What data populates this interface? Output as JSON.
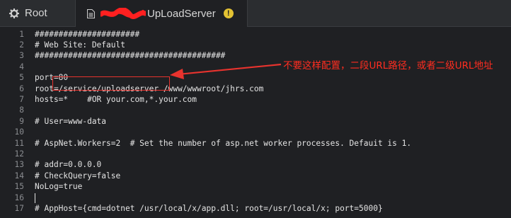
{
  "tabs": [
    {
      "label": "Root"
    },
    {
      "label": "UpLoadServer",
      "warning_glyph": "!"
    }
  ],
  "colors": {
    "accent_annotation": "#e8332e",
    "warning": "#e3c233",
    "background": "#1f2023"
  },
  "icons": [
    "gear-icon",
    "file-icon",
    "warning-icon",
    "redaction-scribble"
  ],
  "editor": {
    "lines": [
      {
        "n": "1",
        "text": "######################"
      },
      {
        "n": "2",
        "text": "# Web Site: Default"
      },
      {
        "n": "3",
        "text": "########################################"
      },
      {
        "n": "4",
        "text": ""
      },
      {
        "n": "5",
        "text": "port=80"
      },
      {
        "n": "6",
        "text": "root=/service/uploadserver /www/wwwroot/jhrs.com"
      },
      {
        "n": "7",
        "text": "hosts=*    #OR your.com,*.your.com"
      },
      {
        "n": "8",
        "text": ""
      },
      {
        "n": "9",
        "text": "# User=www-data"
      },
      {
        "n": "10",
        "text": ""
      },
      {
        "n": "11",
        "text": "# AspNet.Workers=2  # Set the number of asp.net worker processes. Defauit is 1."
      },
      {
        "n": "12",
        "text": ""
      },
      {
        "n": "13",
        "text": "# addr=0.0.0.0"
      },
      {
        "n": "14",
        "text": "# CheckQuery=false"
      },
      {
        "n": "15",
        "text": "NoLog=true"
      },
      {
        "n": "16",
        "text": ""
      },
      {
        "n": "17",
        "text": "# AppHost={cmd=dotnet /usr/local/x/app.dll; root=/usr/local/x; port=5000}"
      }
    ]
  },
  "annotation": {
    "text": "不要这样配置，二段URL路径，或者二级URL地址"
  }
}
